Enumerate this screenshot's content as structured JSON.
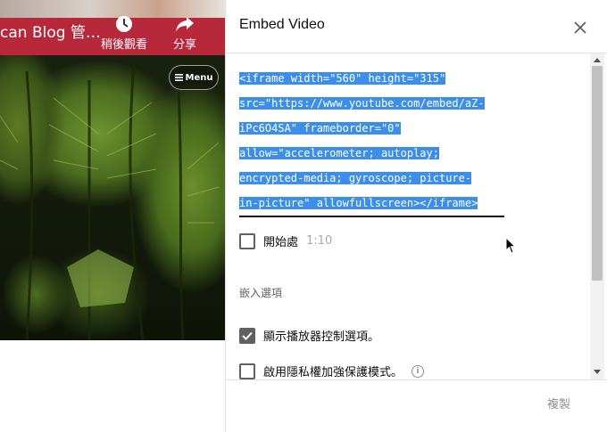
{
  "video": {
    "blog_title": "can Blog 管…",
    "watch_later_label": "稍後觀看",
    "share_label": "分享",
    "menu_label": "Menu",
    "watch_later_icon": "clock-icon",
    "share_icon": "share-arrow-icon",
    "menu_icon": "hamburger-icon"
  },
  "dialog": {
    "title": "Embed Video",
    "close_icon": "close-icon",
    "embed_code_lines": [
      "<iframe width=\"560\" height=\"315\"",
      "src=\"https://www.youtube.com/embed/aZ-",
      "iPc6O4SA\" frameborder=\"0\"",
      "allow=\"accelerometer; autoplay;",
      "encrypted-media; gyroscope; picture-",
      "in-picture\" allowfullscreen></iframe>"
    ],
    "start_at_label": "開始處",
    "start_at_time": "1:10",
    "start_at_checked": false,
    "embed_options_label": "嵌入選項",
    "options": [
      {
        "label": "顯示播放器控制選項。",
        "checked": true
      },
      {
        "label": "啟用隱私權加強保護模式。",
        "checked": false,
        "info_icon": "info-icon",
        "info_text": "i"
      }
    ],
    "copy_label": "複製"
  },
  "colors": {
    "selection": "#3b8eea",
    "brand_red": "#b7283b",
    "checkbox": "#606060"
  }
}
